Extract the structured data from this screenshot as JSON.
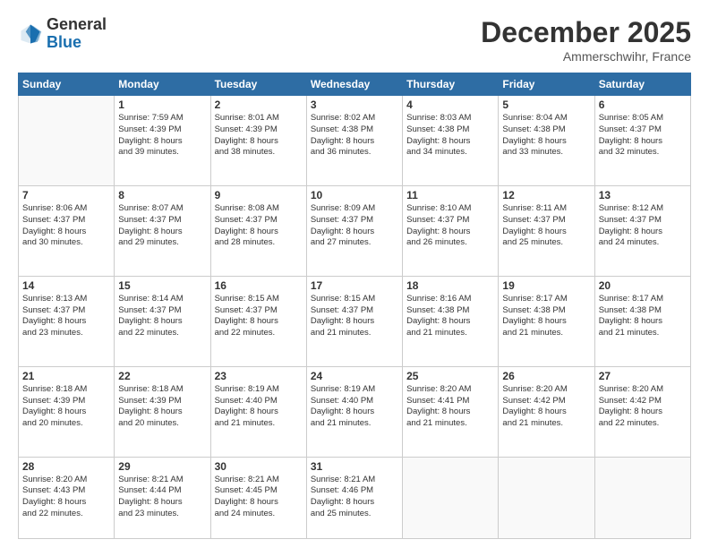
{
  "header": {
    "logo_general": "General",
    "logo_blue": "Blue",
    "month": "December 2025",
    "location": "Ammerschwihr, France"
  },
  "days_of_week": [
    "Sunday",
    "Monday",
    "Tuesday",
    "Wednesday",
    "Thursday",
    "Friday",
    "Saturday"
  ],
  "weeks": [
    [
      {
        "day": "",
        "info": ""
      },
      {
        "day": "1",
        "info": "Sunrise: 7:59 AM\nSunset: 4:39 PM\nDaylight: 8 hours\nand 39 minutes."
      },
      {
        "day": "2",
        "info": "Sunrise: 8:01 AM\nSunset: 4:39 PM\nDaylight: 8 hours\nand 38 minutes."
      },
      {
        "day": "3",
        "info": "Sunrise: 8:02 AM\nSunset: 4:38 PM\nDaylight: 8 hours\nand 36 minutes."
      },
      {
        "day": "4",
        "info": "Sunrise: 8:03 AM\nSunset: 4:38 PM\nDaylight: 8 hours\nand 34 minutes."
      },
      {
        "day": "5",
        "info": "Sunrise: 8:04 AM\nSunset: 4:38 PM\nDaylight: 8 hours\nand 33 minutes."
      },
      {
        "day": "6",
        "info": "Sunrise: 8:05 AM\nSunset: 4:37 PM\nDaylight: 8 hours\nand 32 minutes."
      }
    ],
    [
      {
        "day": "7",
        "info": "Sunrise: 8:06 AM\nSunset: 4:37 PM\nDaylight: 8 hours\nand 30 minutes."
      },
      {
        "day": "8",
        "info": "Sunrise: 8:07 AM\nSunset: 4:37 PM\nDaylight: 8 hours\nand 29 minutes."
      },
      {
        "day": "9",
        "info": "Sunrise: 8:08 AM\nSunset: 4:37 PM\nDaylight: 8 hours\nand 28 minutes."
      },
      {
        "day": "10",
        "info": "Sunrise: 8:09 AM\nSunset: 4:37 PM\nDaylight: 8 hours\nand 27 minutes."
      },
      {
        "day": "11",
        "info": "Sunrise: 8:10 AM\nSunset: 4:37 PM\nDaylight: 8 hours\nand 26 minutes."
      },
      {
        "day": "12",
        "info": "Sunrise: 8:11 AM\nSunset: 4:37 PM\nDaylight: 8 hours\nand 25 minutes."
      },
      {
        "day": "13",
        "info": "Sunrise: 8:12 AM\nSunset: 4:37 PM\nDaylight: 8 hours\nand 24 minutes."
      }
    ],
    [
      {
        "day": "14",
        "info": "Sunrise: 8:13 AM\nSunset: 4:37 PM\nDaylight: 8 hours\nand 23 minutes."
      },
      {
        "day": "15",
        "info": "Sunrise: 8:14 AM\nSunset: 4:37 PM\nDaylight: 8 hours\nand 22 minutes."
      },
      {
        "day": "16",
        "info": "Sunrise: 8:15 AM\nSunset: 4:37 PM\nDaylight: 8 hours\nand 22 minutes."
      },
      {
        "day": "17",
        "info": "Sunrise: 8:15 AM\nSunset: 4:37 PM\nDaylight: 8 hours\nand 21 minutes."
      },
      {
        "day": "18",
        "info": "Sunrise: 8:16 AM\nSunset: 4:38 PM\nDaylight: 8 hours\nand 21 minutes."
      },
      {
        "day": "19",
        "info": "Sunrise: 8:17 AM\nSunset: 4:38 PM\nDaylight: 8 hours\nand 21 minutes."
      },
      {
        "day": "20",
        "info": "Sunrise: 8:17 AM\nSunset: 4:38 PM\nDaylight: 8 hours\nand 21 minutes."
      }
    ],
    [
      {
        "day": "21",
        "info": "Sunrise: 8:18 AM\nSunset: 4:39 PM\nDaylight: 8 hours\nand 20 minutes."
      },
      {
        "day": "22",
        "info": "Sunrise: 8:18 AM\nSunset: 4:39 PM\nDaylight: 8 hours\nand 20 minutes."
      },
      {
        "day": "23",
        "info": "Sunrise: 8:19 AM\nSunset: 4:40 PM\nDaylight: 8 hours\nand 21 minutes."
      },
      {
        "day": "24",
        "info": "Sunrise: 8:19 AM\nSunset: 4:40 PM\nDaylight: 8 hours\nand 21 minutes."
      },
      {
        "day": "25",
        "info": "Sunrise: 8:20 AM\nSunset: 4:41 PM\nDaylight: 8 hours\nand 21 minutes."
      },
      {
        "day": "26",
        "info": "Sunrise: 8:20 AM\nSunset: 4:42 PM\nDaylight: 8 hours\nand 21 minutes."
      },
      {
        "day": "27",
        "info": "Sunrise: 8:20 AM\nSunset: 4:42 PM\nDaylight: 8 hours\nand 22 minutes."
      }
    ],
    [
      {
        "day": "28",
        "info": "Sunrise: 8:20 AM\nSunset: 4:43 PM\nDaylight: 8 hours\nand 22 minutes."
      },
      {
        "day": "29",
        "info": "Sunrise: 8:21 AM\nSunset: 4:44 PM\nDaylight: 8 hours\nand 23 minutes."
      },
      {
        "day": "30",
        "info": "Sunrise: 8:21 AM\nSunset: 4:45 PM\nDaylight: 8 hours\nand 24 minutes."
      },
      {
        "day": "31",
        "info": "Sunrise: 8:21 AM\nSunset: 4:46 PM\nDaylight: 8 hours\nand 25 minutes."
      },
      {
        "day": "",
        "info": ""
      },
      {
        "day": "",
        "info": ""
      },
      {
        "day": "",
        "info": ""
      }
    ]
  ]
}
